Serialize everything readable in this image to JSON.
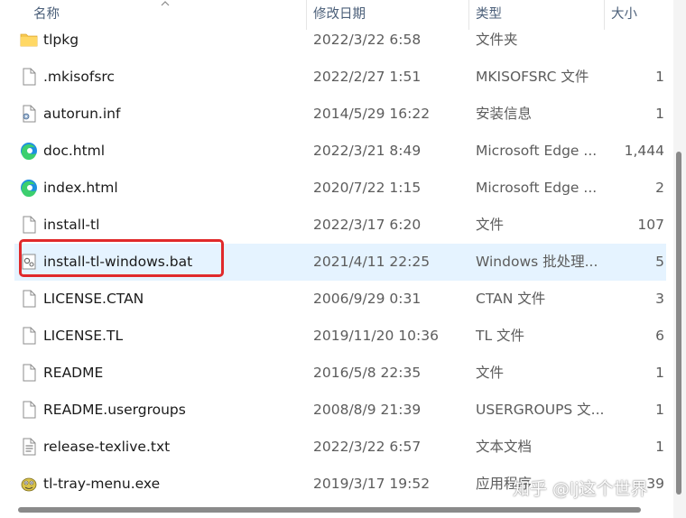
{
  "columns": {
    "name": "名称",
    "date": "修改日期",
    "type": "类型",
    "size": "大小"
  },
  "files": [
    {
      "name": "tlpkg",
      "date": "2022/3/22 6:58",
      "type": "文件夹",
      "size": "",
      "icon": "folder-icon"
    },
    {
      "name": ".mkisofsrc",
      "date": "2022/2/27 1:51",
      "type": "MKISOFSRC 文件",
      "size": "1",
      "icon": "file-icon"
    },
    {
      "name": "autorun.inf",
      "date": "2014/5/29 16:22",
      "type": "安装信息",
      "size": "1",
      "icon": "setup-info-icon"
    },
    {
      "name": "doc.html",
      "date": "2022/3/21 8:49",
      "type": "Microsoft Edge ...",
      "size": "1,444",
      "icon": "edge-icon"
    },
    {
      "name": "index.html",
      "date": "2020/7/22 1:15",
      "type": "Microsoft Edge ...",
      "size": "2",
      "icon": "edge-icon"
    },
    {
      "name": "install-tl",
      "date": "2022/3/17 6:20",
      "type": "文件",
      "size": "107",
      "icon": "file-icon"
    },
    {
      "name": "install-tl-windows.bat",
      "date": "2021/4/11 22:25",
      "type": "Windows 批处理...",
      "size": "5",
      "icon": "batch-file-icon",
      "selected": true
    },
    {
      "name": "LICENSE.CTAN",
      "date": "2006/9/29 0:31",
      "type": "CTAN 文件",
      "size": "3",
      "icon": "file-icon"
    },
    {
      "name": "LICENSE.TL",
      "date": "2019/11/20 10:36",
      "type": "TL 文件",
      "size": "6",
      "icon": "file-icon"
    },
    {
      "name": "README",
      "date": "2016/5/8 22:35",
      "type": "文件",
      "size": "1",
      "icon": "file-icon"
    },
    {
      "name": "README.usergroups",
      "date": "2008/8/9 21:39",
      "type": "USERGROUPS 文...",
      "size": "1",
      "icon": "file-icon"
    },
    {
      "name": "release-texlive.txt",
      "date": "2022/3/22 6:57",
      "type": "文本文档",
      "size": "1",
      "icon": "text-file-icon"
    },
    {
      "name": "tl-tray-menu.exe",
      "date": "2019/3/17 19:52",
      "type": "应用程序",
      "size": "39",
      "icon": "app-exe-icon"
    }
  ],
  "watermark": "知乎 @lj这个世界"
}
